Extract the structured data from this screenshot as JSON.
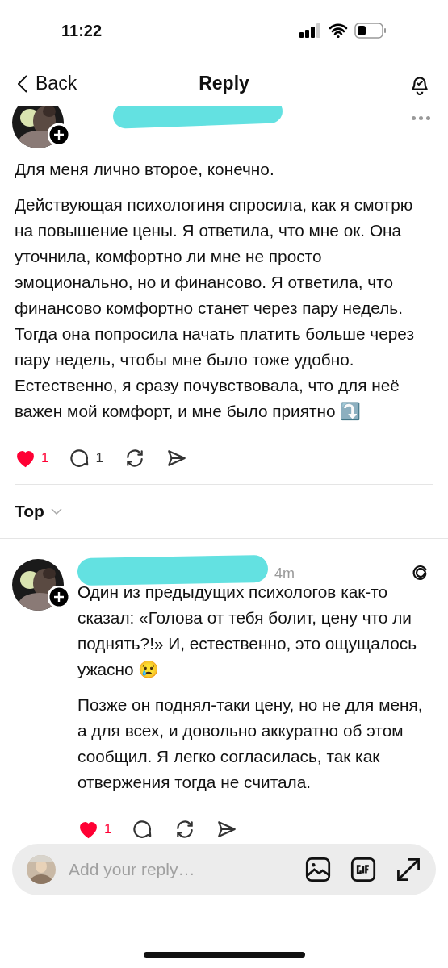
{
  "status_bar": {
    "time": "11:22"
  },
  "nav": {
    "back": "Back",
    "title": "Reply"
  },
  "post": {
    "paragraphs": [
      "Для меня лично второе, конечно.",
      "Действующая психологиня спросила, как я смотрю на повышение цены. Я ответила, что мне ок. Она уточнила, комфортно ли мне не просто эмоционально, но и финансово. Я ответила, что финансово комфортно станет через пару недель. Тогда она попросила начать платить больше через пару недель, чтобы мне было тоже удобно. Естественно, я сразу почувствовала, что для неё важен мой комфорт, и мне было приятно ⤵️"
    ],
    "liked": true,
    "likes": "1",
    "replies": "1"
  },
  "sort": {
    "label": "Top"
  },
  "reply": {
    "time": "4m",
    "paragraphs": [
      "Один из предыдущих психологов как-то сказал: «Голова от тебя болит, цену что ли поднять?!» И, естественно, это ощущалось ужасно 😢",
      "Позже он поднял-таки цену, но не для меня, а для всех, и довольно аккуратно об этом сообщил. Я легко согласилась, так как отвержения тогда не считала."
    ],
    "liked": true,
    "likes": "1"
  },
  "composer": {
    "placeholder": "Add your reply…"
  }
}
